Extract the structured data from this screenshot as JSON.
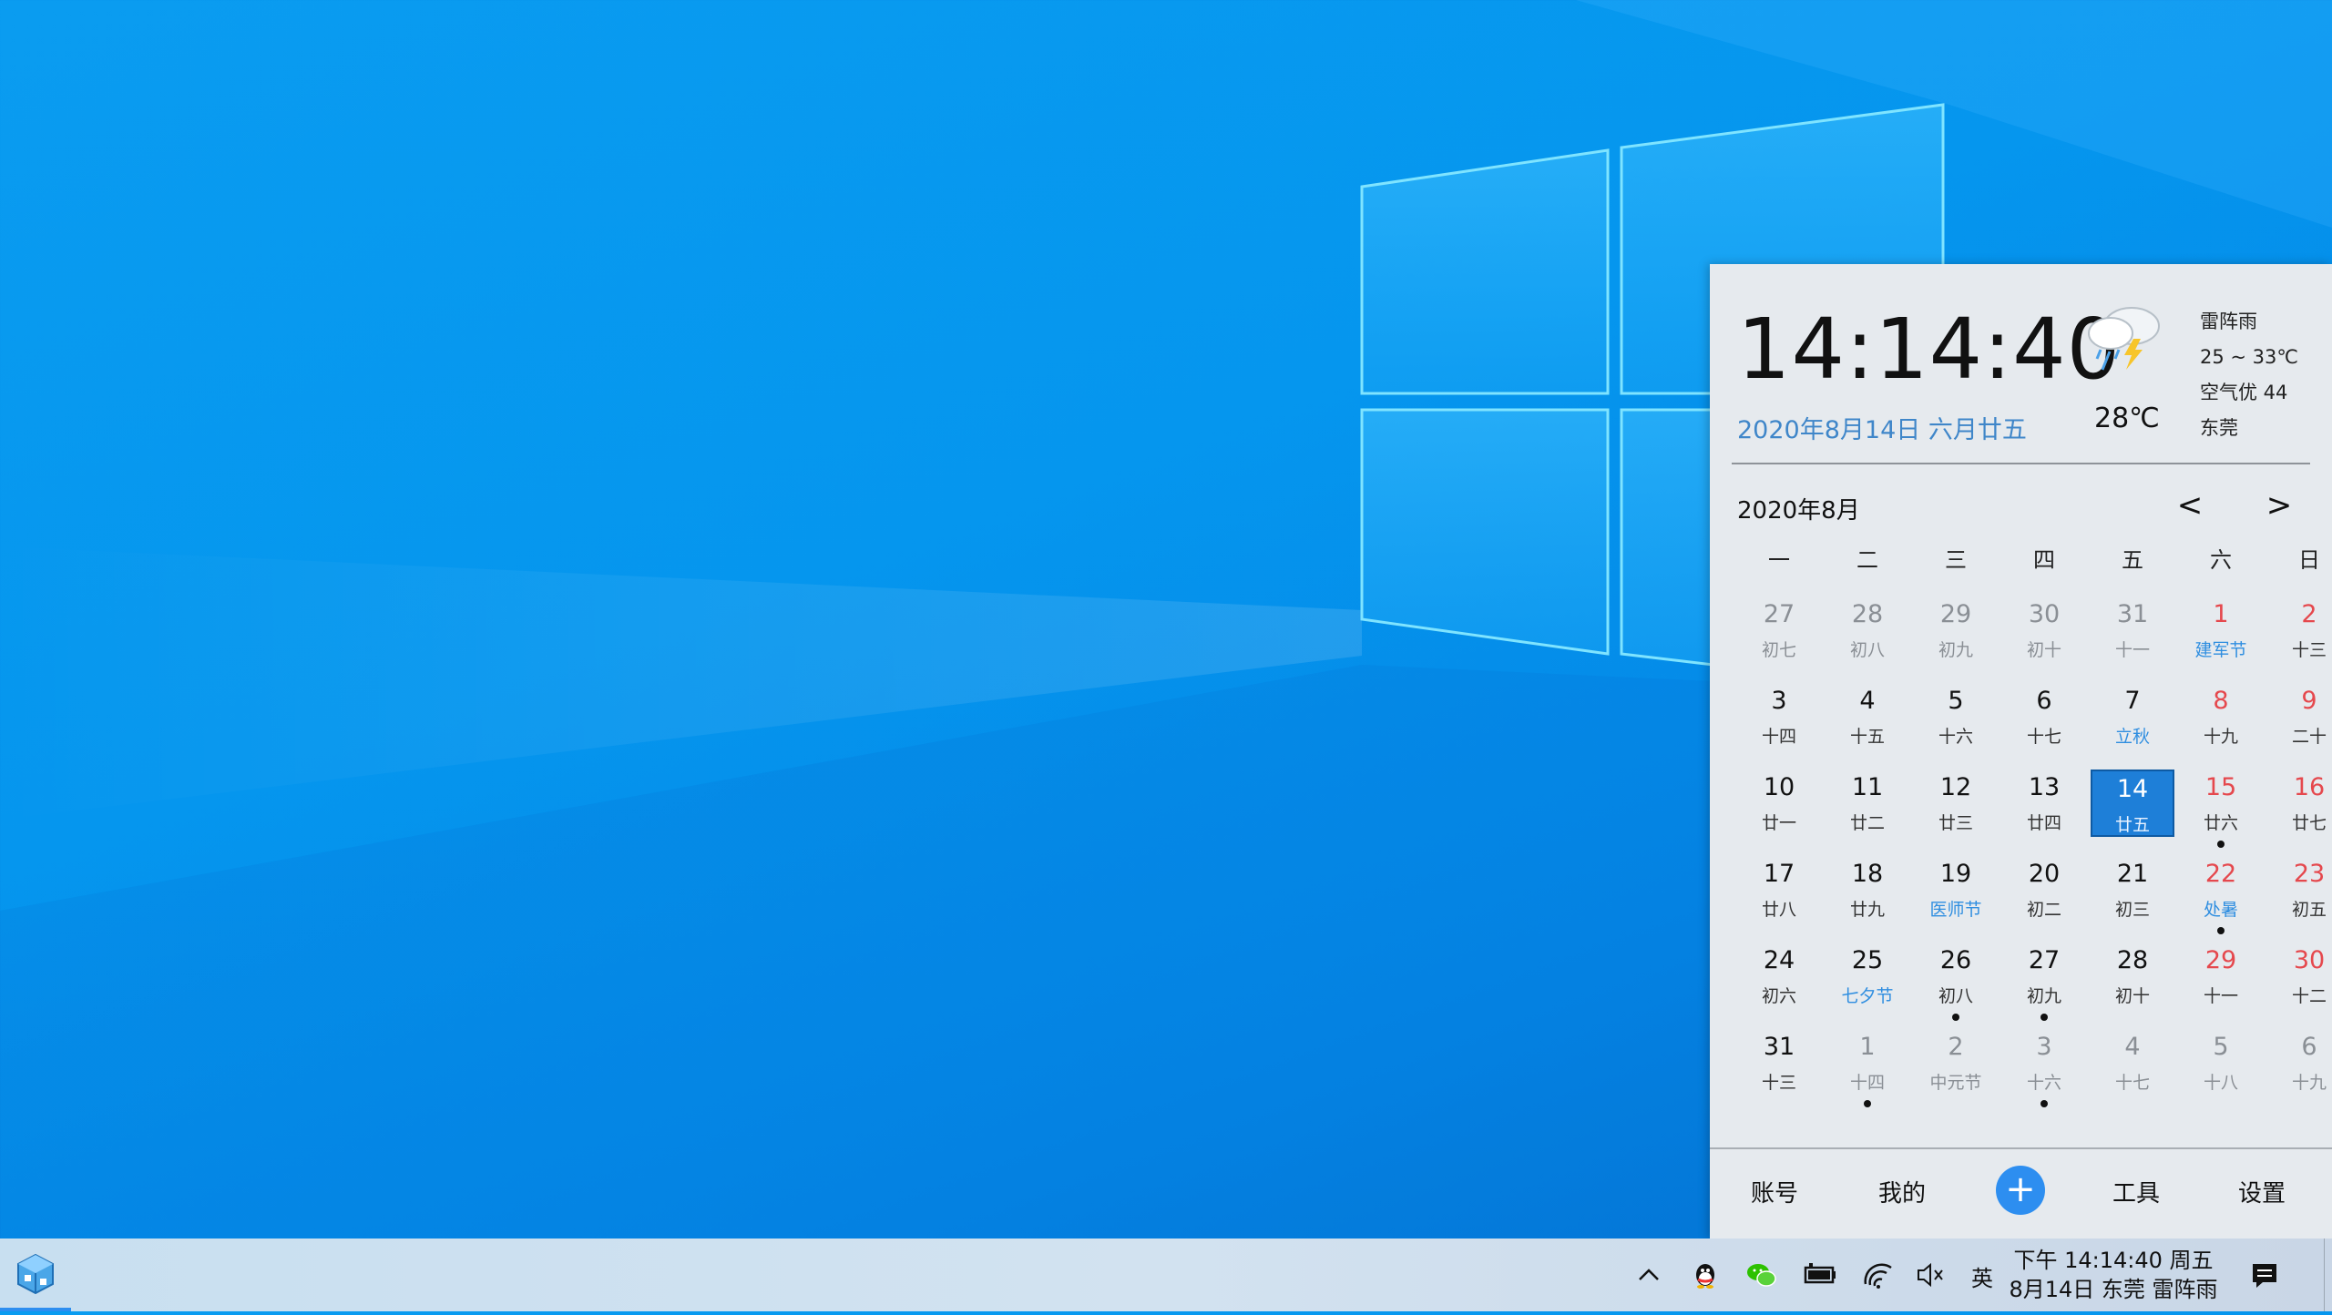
{
  "flyout": {
    "time": "14:14:40",
    "date": "2020年8月14日 六月廿五",
    "current_temp": "28℃",
    "weather": {
      "icon": "thunderstorm-rain-icon",
      "condition": "雷阵雨",
      "range": "25 ~ 33℃",
      "air": "空气优 44",
      "city": "东莞"
    },
    "month_label": "2020年8月",
    "prev": "<",
    "next": ">",
    "weekdays": [
      "一",
      "二",
      "三",
      "四",
      "五",
      "六",
      "日"
    ],
    "weeks": [
      [
        {
          "d": "27",
          "l": "初七",
          "muted": true
        },
        {
          "d": "28",
          "l": "初八",
          "muted": true
        },
        {
          "d": "29",
          "l": "初九",
          "muted": true
        },
        {
          "d": "30",
          "l": "初十",
          "muted": true
        },
        {
          "d": "31",
          "l": "十一",
          "muted": true
        },
        {
          "d": "1",
          "l": "建军节",
          "weekend": true,
          "festival": true
        },
        {
          "d": "2",
          "l": "十三",
          "weekend": true
        }
      ],
      [
        {
          "d": "3",
          "l": "十四"
        },
        {
          "d": "4",
          "l": "十五"
        },
        {
          "d": "5",
          "l": "十六"
        },
        {
          "d": "6",
          "l": "十七"
        },
        {
          "d": "7",
          "l": "立秋",
          "festival": true
        },
        {
          "d": "8",
          "l": "十九",
          "weekend": true
        },
        {
          "d": "9",
          "l": "二十",
          "weekend": true
        }
      ],
      [
        {
          "d": "10",
          "l": "廿一"
        },
        {
          "d": "11",
          "l": "廿二"
        },
        {
          "d": "12",
          "l": "廿三"
        },
        {
          "d": "13",
          "l": "廿四"
        },
        {
          "d": "14",
          "l": "廿五",
          "selected": true
        },
        {
          "d": "15",
          "l": "廿六",
          "weekend": true,
          "dot": true
        },
        {
          "d": "16",
          "l": "廿七",
          "weekend": true
        }
      ],
      [
        {
          "d": "17",
          "l": "廿八"
        },
        {
          "d": "18",
          "l": "廿九"
        },
        {
          "d": "19",
          "l": "医师节",
          "festival": true
        },
        {
          "d": "20",
          "l": "初二"
        },
        {
          "d": "21",
          "l": "初三"
        },
        {
          "d": "22",
          "l": "处暑",
          "weekend": true,
          "festival": true,
          "dot": true
        },
        {
          "d": "23",
          "l": "初五",
          "weekend": true
        }
      ],
      [
        {
          "d": "24",
          "l": "初六"
        },
        {
          "d": "25",
          "l": "七夕节",
          "festival": true
        },
        {
          "d": "26",
          "l": "初八",
          "dot": true
        },
        {
          "d": "27",
          "l": "初九",
          "dot": true
        },
        {
          "d": "28",
          "l": "初十"
        },
        {
          "d": "29",
          "l": "十一",
          "weekend": true
        },
        {
          "d": "30",
          "l": "十二",
          "weekend": true
        }
      ],
      [
        {
          "d": "31",
          "l": "十三"
        },
        {
          "d": "1",
          "l": "十四",
          "muted": true,
          "dot": true
        },
        {
          "d": "2",
          "l": "中元节",
          "muted": true
        },
        {
          "d": "3",
          "l": "十六",
          "muted": true,
          "dot": true
        },
        {
          "d": "4",
          "l": "十七",
          "muted": true
        },
        {
          "d": "5",
          "l": "十八",
          "muted": true
        },
        {
          "d": "6",
          "l": "十九",
          "muted": true
        }
      ]
    ],
    "footer": {
      "account": "账号",
      "mine": "我的",
      "plus": "+",
      "tools": "工具",
      "settings": "设置"
    }
  },
  "taskbar": {
    "tray_chevron": "^",
    "ime": "英",
    "clock_line1": "下午 14:14:40 周五",
    "clock_line2": "8月14日 东莞 雷阵雨",
    "icons": [
      "app-cube-icon",
      "chevron-up-icon",
      "qq-penguin-icon",
      "wechat-icon",
      "battery-icon",
      "wifi-icon",
      "volume-muted-icon",
      "notification-icon"
    ]
  },
  "colors": {
    "weekend_red": "#e5484d",
    "festival_blue": "#2f8ee0",
    "muted_gray": "#8a8f95",
    "selected_blue": "#1e7fd8",
    "accent": "#2d8ef0"
  }
}
